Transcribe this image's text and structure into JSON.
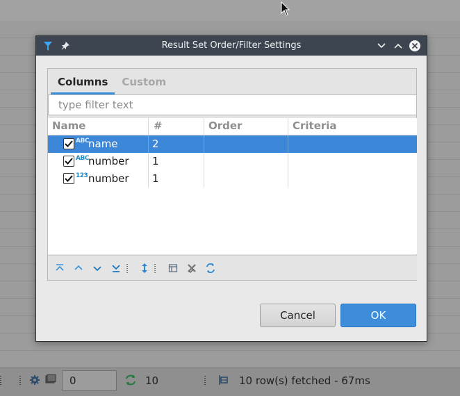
{
  "dialog": {
    "title": "Result Set Order/Filter Settings",
    "tabs": [
      {
        "label": "Columns",
        "active": true
      },
      {
        "label": "Custom",
        "active": false
      }
    ],
    "filter_placeholder": "type filter text",
    "headers": [
      "Name",
      "#",
      "Order",
      "Criteria"
    ],
    "rows": [
      {
        "checked": true,
        "type_icon": "ABC",
        "name": "name",
        "num": "2",
        "order": "",
        "criteria": "",
        "selected": true
      },
      {
        "checked": true,
        "type_icon": "ABC",
        "name": "number",
        "num": "1",
        "order": "",
        "criteria": "",
        "selected": false
      },
      {
        "checked": true,
        "type_icon": "123",
        "name": "number",
        "num": "1",
        "order": "",
        "criteria": "",
        "selected": false
      }
    ],
    "cancel_label": "Cancel",
    "ok_label": "OK"
  },
  "statusbar": {
    "fetch_size": "0",
    "refresh_count": "10",
    "status_text": "10 row(s) fetched - 67ms"
  },
  "colors": {
    "accent": "#3d87d8",
    "titlebar": "#3d4550",
    "type_icon": "#1f8bc6"
  }
}
